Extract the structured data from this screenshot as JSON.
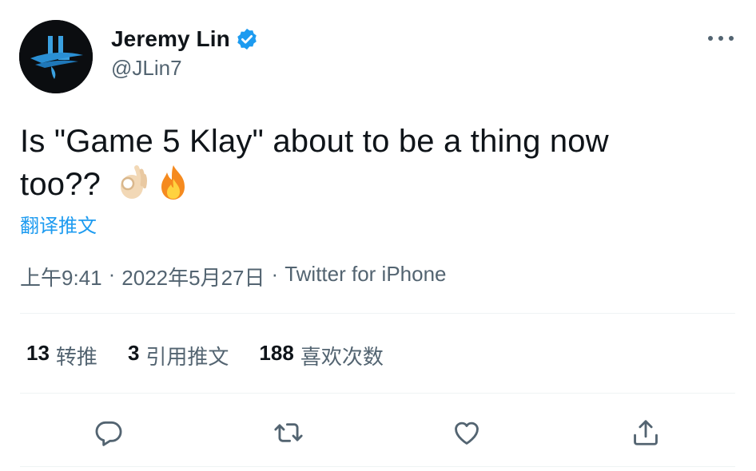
{
  "author": {
    "display_name": "Jeremy Lin",
    "handle": "@JLin7",
    "verified_icon": "verified-badge-icon",
    "avatar_icon": "jl-logo-avatar"
  },
  "menu": {
    "icon": "more-horizontal-icon"
  },
  "tweet": {
    "text_line1": "Is \"Game 5 Klay\" about to be a thing now",
    "text_line2": "too??",
    "emojis": [
      "ok-hand-emoji",
      "fire-emoji"
    ],
    "translate_label": "翻译推文"
  },
  "meta": {
    "time": "上午9:41",
    "separator": "·",
    "date": "2022年5月27日",
    "source": "Twitter for iPhone"
  },
  "stats": [
    {
      "count": "13",
      "label": "转推"
    },
    {
      "count": "3",
      "label": "引用推文"
    },
    {
      "count": "188",
      "label": "喜欢次数"
    }
  ],
  "actions": [
    "reply-icon",
    "retweet-icon",
    "like-icon",
    "share-icon"
  ],
  "colors": {
    "text": "#0f1419",
    "secondary": "#536471",
    "link": "#1d9bf0",
    "verified": "#1d9bf0",
    "divider": "#eff3f4"
  }
}
